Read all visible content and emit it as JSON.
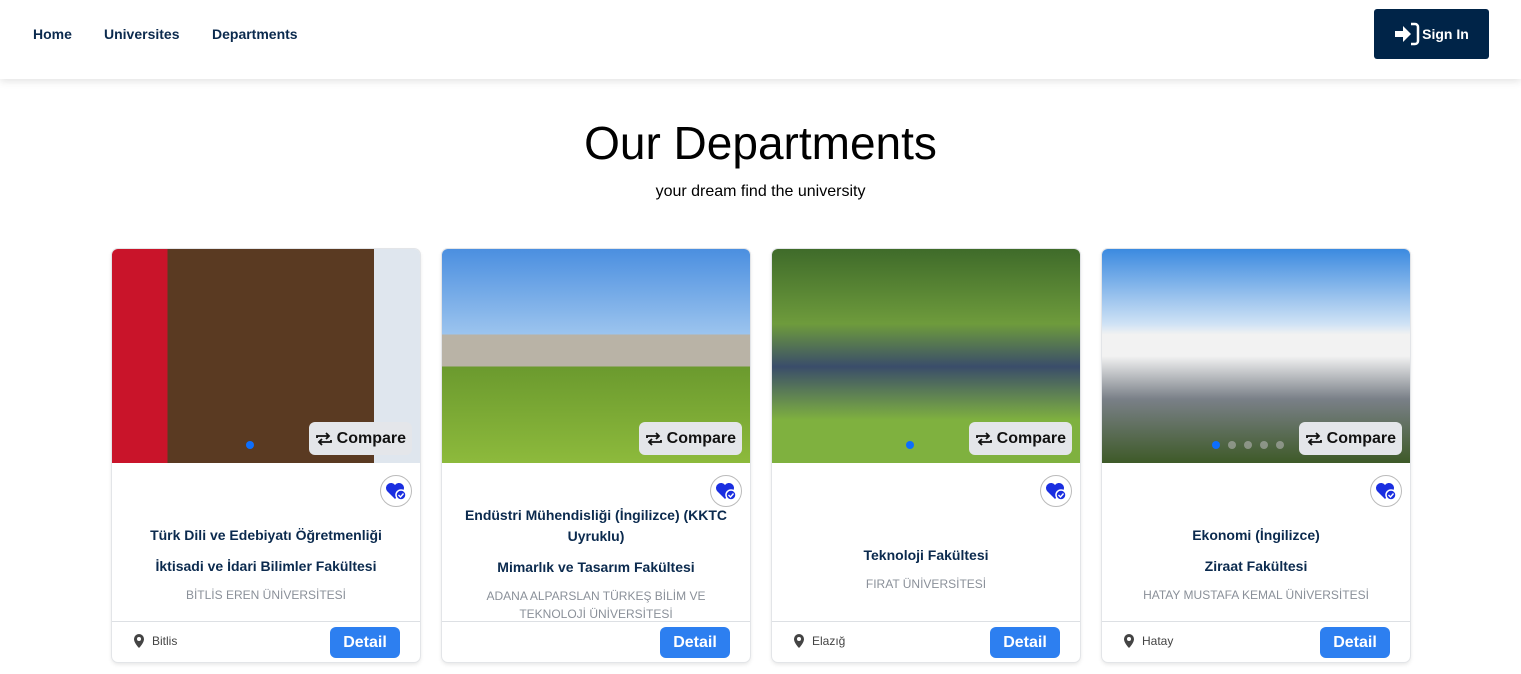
{
  "nav": {
    "items": [
      "Home",
      "Universites",
      "Departments"
    ],
    "signin": "Sign In"
  },
  "header": {
    "title": "Our Departments",
    "subtitle": "your dream find the university"
  },
  "compare_label": "Compare",
  "detail_label": "Detail",
  "colors": {
    "primary": "#002448",
    "accent": "#2d7ff0",
    "heart": "#1a2ee0"
  },
  "cards": [
    {
      "department": "Türk Dili ve Edebiyatı Öğretmenliği",
      "faculty": "İktisadi ve İdari Bilimler Fakültesi",
      "university": "BİTLİS EREN ÜNİVERSİTESİ",
      "city": "Bitlis",
      "slides": 1
    },
    {
      "department": "Endüstri Mühendisliği (İngilizce) (KKTC Uyruklu)",
      "faculty": "Mimarlık ve Tasarım Fakültesi",
      "university": "ADANA ALPARSLAN TÜRKEŞ BİLİM VE TEKNOLOJİ ÜNİVERSİTESİ",
      "city": "",
      "slides": 0
    },
    {
      "department": "",
      "faculty": "Teknoloji Fakültesi",
      "university": "FIRAT ÜNİVERSİTESİ",
      "city": "Elazığ",
      "slides": 1
    },
    {
      "department": "Ekonomi (İngilizce)",
      "faculty": "Ziraat Fakültesi",
      "university": "HATAY MUSTAFA KEMAL ÜNİVERSİTESİ",
      "city": "Hatay",
      "slides": 5
    }
  ]
}
